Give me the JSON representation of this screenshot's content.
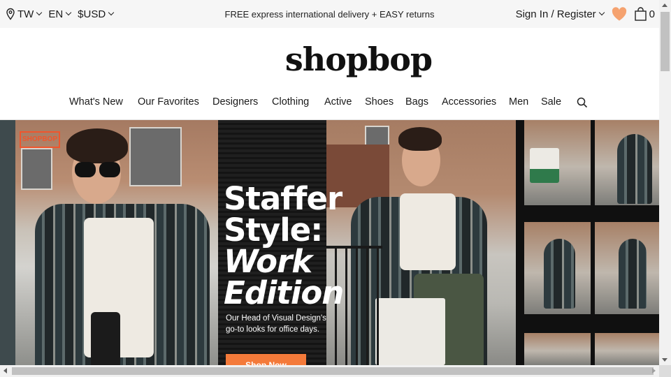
{
  "topbar": {
    "country": "TW",
    "language": "EN",
    "currency": "$USD",
    "promo": "FREE express international delivery + EASY returns",
    "signin": "Sign In / Register",
    "bag_count": "0",
    "heart_color": "#f5a26f"
  },
  "logo": "shopbop",
  "nav": {
    "items": [
      "What's New",
      "Our Favorites",
      "Designers",
      "Clothing",
      "Active",
      "Shoes",
      "Bags",
      "Accessories",
      "Men",
      "Sale"
    ]
  },
  "hero": {
    "title_line1": "Staffer",
    "title_line2": "Style:",
    "title_line3": "Work",
    "title_line4": "Edition",
    "subtitle": "Our Head of Visual Design's go-to looks for office days.",
    "cta": "Shop Now",
    "cta_color": "#f47a3a"
  }
}
